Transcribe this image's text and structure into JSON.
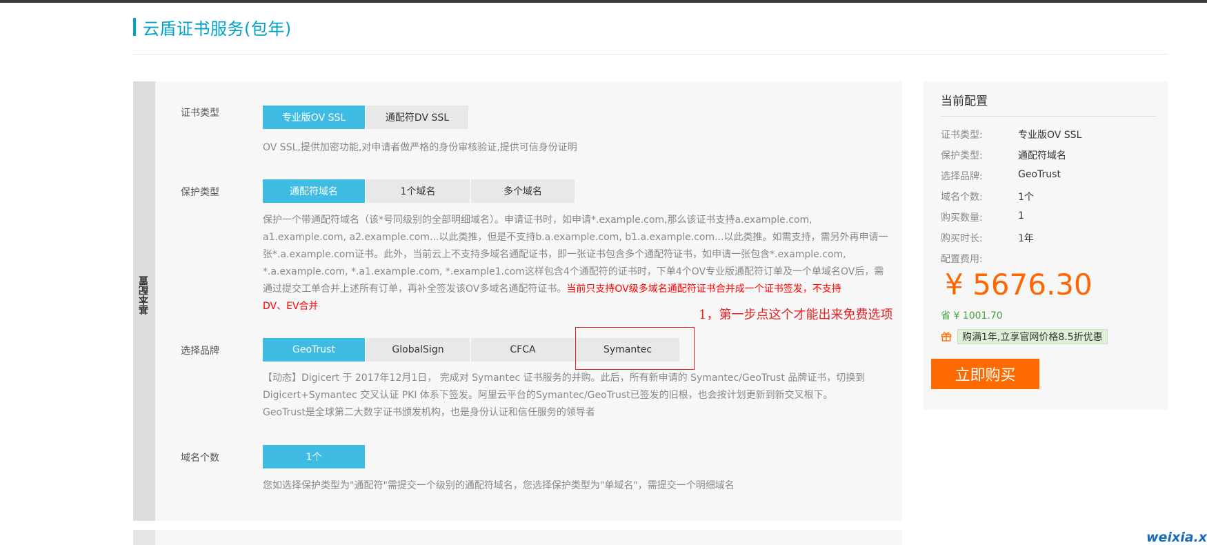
{
  "page": {
    "title": "云盾证书服务(包年)"
  },
  "section": {
    "label": "基本配置"
  },
  "cert_type": {
    "label": "证书类型",
    "options": [
      "专业版OV SSL",
      "通配符DV SSL"
    ],
    "desc": "OV SSL,提供加密功能,对申请者做严格的身份审核验证,提供可信身份证明"
  },
  "protect_type": {
    "label": "保护类型",
    "options": [
      "通配符域名",
      "1个域名",
      "多个域名"
    ],
    "desc_lines": [
      "保护一个带通配符域名（该*号同级别的全部明细域名）。申请证书时，如申请*.example.com,那么该证书支持a.example.com,",
      "a1.example.com, a2.example.com...以此类推，但是不支持b.a.example.com, b1.a.example.com...以此类推。如需支持，需另外再申请一",
      "张*.a.example.com证书。此外，当前云上不支持多域名通配证书，即一张证书包含多个通配符证书，如申请一张包含*.example.com,",
      "*.a.example.com, *.a1.example.com, *.example1.com这样包含4个通配符的证书时，下单4个OV专业版通配符订单及一个单域名OV后，需",
      "通过提交工单合并上述所有订单，再补全签发该OV多域名通配符证书。"
    ],
    "desc_red_1": "当前只支持OV级多域名通配符证书合并成一个证书签发，不支持",
    "desc_red_2": "DV、EV合并"
  },
  "brand": {
    "label": "选择品牌",
    "options": [
      "GeoTrust",
      "GlobalSign",
      "CFCA",
      "Symantec"
    ],
    "desc_lines": [
      "【动态】Digicert 于 2017年12月1日， 完成对 Symantec 证书服务的并购。此后，所有新申请的 Symantec/GeoTrust 品牌证书，切换到",
      "Digicert+Symantec 交叉认证 PKI 体系下签发。阿里云平台的Symantec/GeoTrust已签发的旧根，也会按计划更新到新交叉根下。",
      "GeoTrust是全球第二大数字证书颁发机构，也是身份认证和信任服务的领导者"
    ]
  },
  "domain_count": {
    "label": "域名个数",
    "options": [
      "1个"
    ],
    "desc": "您如选择保护类型为\"通配符\"需提交一个级别的通配符域名，您选择保护类型为\"单域名\"，需提交一个明细域名"
  },
  "annotation": {
    "text": "1，第一步点这个才能出来免费选项"
  },
  "config": {
    "title": "当前配置",
    "items": [
      {
        "key": "证书类型:",
        "value": "专业版OV SSL"
      },
      {
        "key": "保护类型:",
        "value": "通配符域名"
      },
      {
        "key": "选择品牌:",
        "value": "GeoTrust"
      },
      {
        "key": "域名个数:",
        "value": "1个"
      },
      {
        "key": "购买数量:",
        "value": "1"
      },
      {
        "key": "购买时长:",
        "value": "1年"
      }
    ],
    "fee_label": "配置费用:",
    "price": "¥ 5676.30",
    "save": "省 ¥ 1001.70",
    "promo": "购满1年,立享官网价格8.5折优惠",
    "buy_label": "立即购买"
  },
  "watermark": "weixia.xin",
  "colors": {
    "accent": "#3fbce3",
    "title": "#00a2ca",
    "price": "#ff6600",
    "buy": "#ff6a00",
    "annotation": "#e02020"
  }
}
